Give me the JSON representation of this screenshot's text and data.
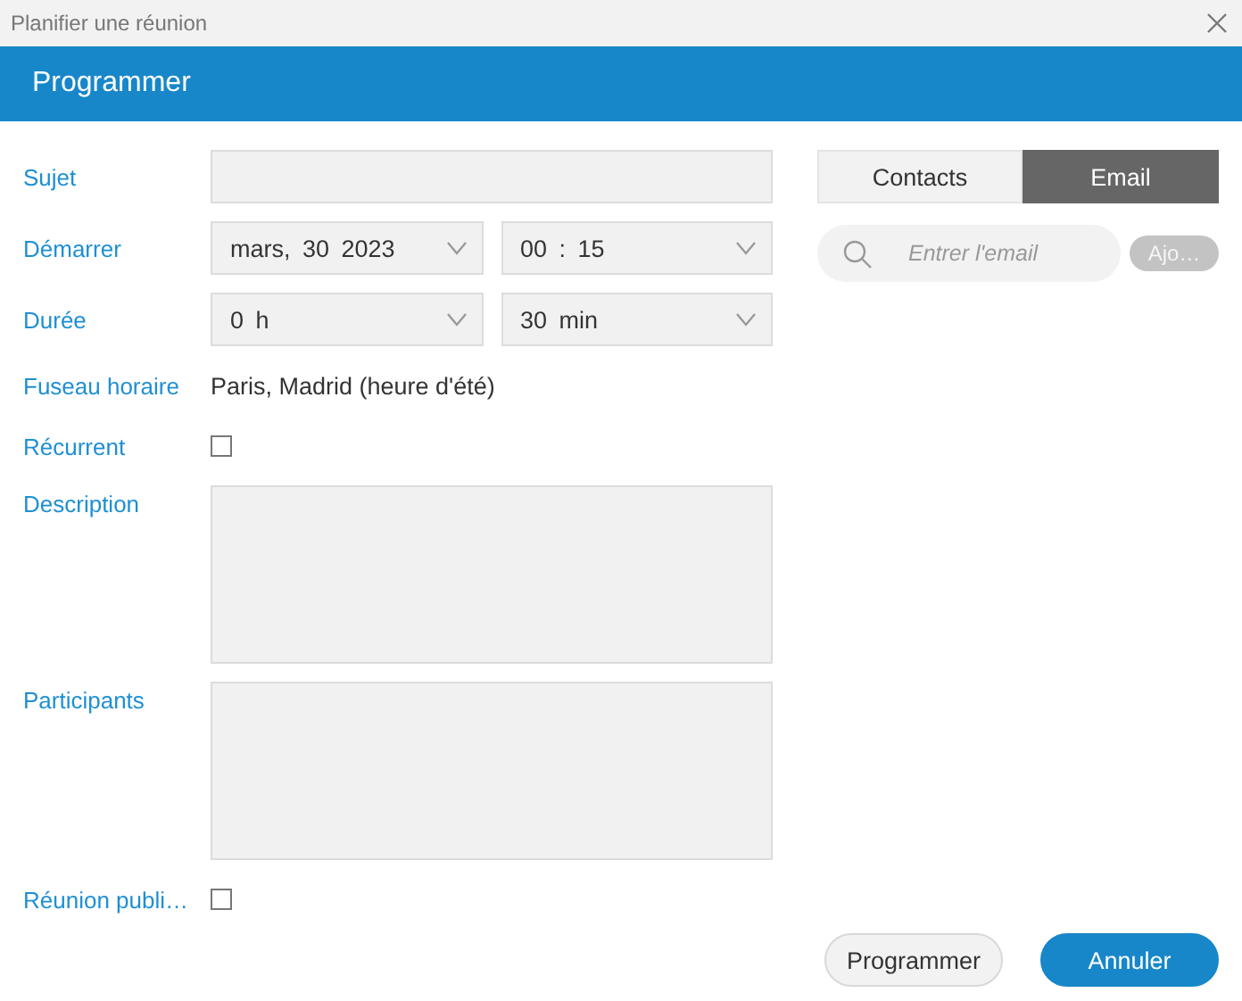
{
  "window": {
    "title": "Planifier une réunion"
  },
  "header": {
    "title": "Programmer"
  },
  "form": {
    "rows": [
      {
        "kind": "input",
        "label": "Sujet"
      },
      {
        "kind": "selects",
        "label": "Démarrer",
        "selects": [
          {
            "value": "mars, 30 2023"
          },
          {
            "value": "00 : 15"
          }
        ]
      },
      {
        "kind": "selects",
        "label": "Durée",
        "selects": [
          {
            "value": "0 h"
          },
          {
            "value": "30 min"
          }
        ]
      },
      {
        "kind": "text",
        "label": "Fuseau horaire",
        "value": "Paris, Madrid (heure d'été)"
      },
      {
        "kind": "checkbox",
        "label": "Récurrent",
        "checked": false
      },
      {
        "kind": "textarea",
        "label": "Description"
      },
      {
        "kind": "textarea",
        "label": "Participants"
      },
      {
        "kind": "checkbox",
        "label": "Réunion publi…",
        "checked": false
      }
    ]
  },
  "side": {
    "tabs": [
      {
        "label": "Contacts",
        "selected": false
      },
      {
        "label": "Email",
        "selected": true
      }
    ],
    "email": {
      "placeholder": "Entrer l'email"
    },
    "add_button": {
      "label": "Ajo…",
      "disabled": true
    }
  },
  "buttons": [
    {
      "label": "Programmer",
      "kind": "secondary"
    },
    {
      "label": "Annuler",
      "kind": "primary"
    }
  ]
}
